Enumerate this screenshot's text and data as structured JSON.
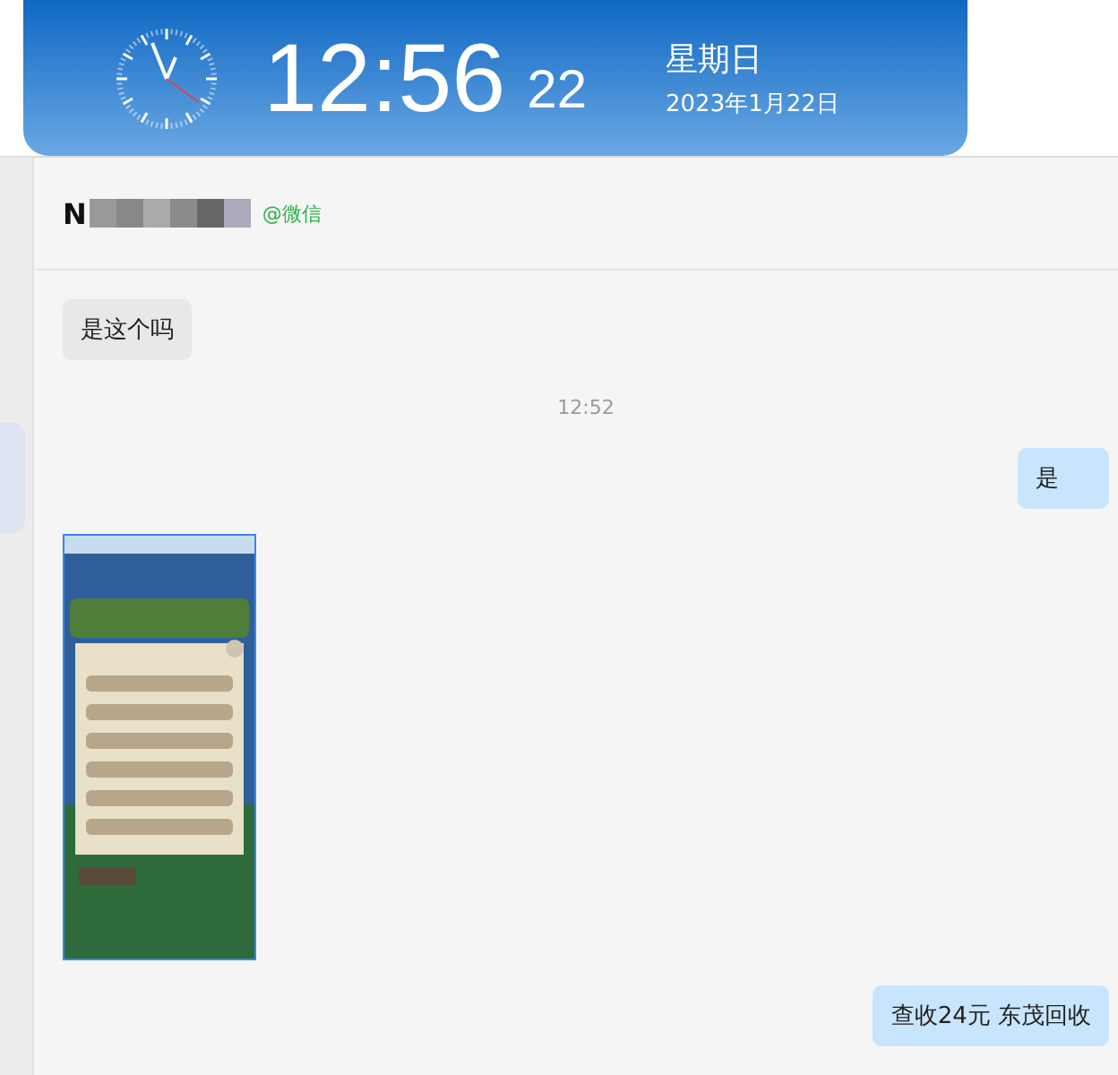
{
  "clock_widget": {
    "time": "12:56",
    "seconds": "22",
    "weekday": "星期日",
    "date": "2023年1月22日"
  },
  "chat": {
    "contact": {
      "name": "N",
      "source": "@微信"
    },
    "messages": [
      {
        "kind": "text",
        "outgoing": false,
        "text": "是这个吗"
      },
      {
        "kind": "time",
        "text": "12:52"
      },
      {
        "kind": "text",
        "outgoing": true,
        "text": "是"
      },
      {
        "kind": "picture",
        "outgoing": false
      },
      {
        "kind": "text",
        "outgoing": true,
        "text": "查收24元 东茂回收"
      }
    ]
  }
}
